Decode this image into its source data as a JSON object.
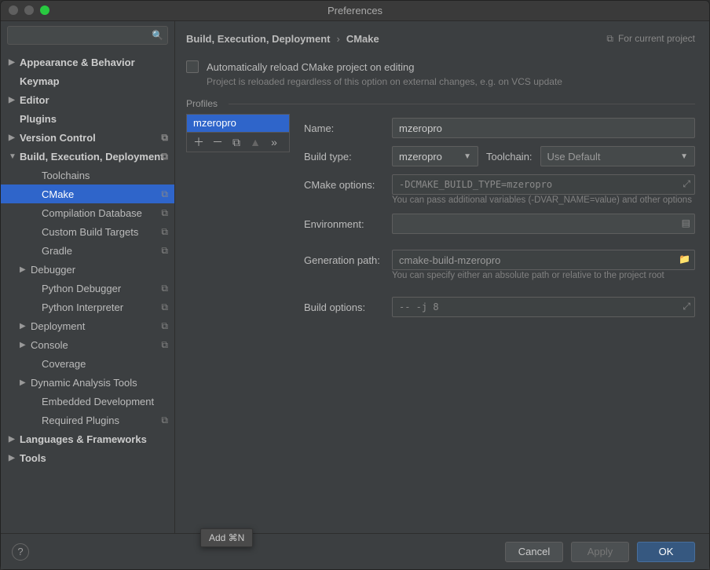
{
  "title": "Preferences",
  "search": {
    "placeholder": ""
  },
  "sidebar": {
    "items": [
      {
        "label": "Appearance & Behavior",
        "bold": true,
        "arrow": "▶"
      },
      {
        "label": "Keymap",
        "bold": true,
        "arrow": ""
      },
      {
        "label": "Editor",
        "bold": true,
        "arrow": "▶"
      },
      {
        "label": "Plugins",
        "bold": true,
        "arrow": ""
      },
      {
        "label": "Version Control",
        "bold": true,
        "arrow": "▶",
        "copy": true
      },
      {
        "label": "Build, Execution, Deployment",
        "bold": true,
        "arrow": "▼",
        "copy": true
      },
      {
        "label": "Toolchains",
        "indent": 2,
        "arrow": ""
      },
      {
        "label": "CMake",
        "indent": 2,
        "arrow": "",
        "selected": true,
        "copy": true
      },
      {
        "label": "Compilation Database",
        "indent": 2,
        "arrow": "",
        "copy": true
      },
      {
        "label": "Custom Build Targets",
        "indent": 2,
        "arrow": "",
        "copy": true
      },
      {
        "label": "Gradle",
        "indent": 2,
        "arrow": "",
        "copy": true
      },
      {
        "label": "Debugger",
        "indent": 1,
        "arrow": "▶"
      },
      {
        "label": "Python Debugger",
        "indent": 2,
        "arrow": "",
        "copy": true
      },
      {
        "label": "Python Interpreter",
        "indent": 2,
        "arrow": "",
        "copy": true
      },
      {
        "label": "Deployment",
        "indent": 1,
        "arrow": "▶",
        "copy": true
      },
      {
        "label": "Console",
        "indent": 1,
        "arrow": "▶",
        "copy": true
      },
      {
        "label": "Coverage",
        "indent": 2,
        "arrow": ""
      },
      {
        "label": "Dynamic Analysis Tools",
        "indent": 1,
        "arrow": "▶"
      },
      {
        "label": "Embedded Development",
        "indent": 2,
        "arrow": ""
      },
      {
        "label": "Required Plugins",
        "indent": 2,
        "arrow": "",
        "copy": true
      },
      {
        "label": "Languages & Frameworks",
        "bold": true,
        "arrow": "▶"
      },
      {
        "label": "Tools",
        "bold": true,
        "arrow": "▶"
      }
    ]
  },
  "breadcrumb": {
    "a": "Build, Execution, Deployment",
    "b": "CMake",
    "project_label": "For current project"
  },
  "auto": {
    "label": "Automatically reload CMake project on editing",
    "sub": "Project is reloaded regardless of this option on external changes, e.g. on VCS update"
  },
  "profiles_label": "Profiles",
  "profile_list": {
    "item": "mzeropro"
  },
  "form": {
    "name_label": "Name:",
    "name_value": "mzeropro",
    "build_type_label": "Build type:",
    "build_type_value": "mzeropro",
    "toolchain_label": "Toolchain:",
    "toolchain_value": "Use Default",
    "cmake_opts_label": "CMake options:",
    "cmake_opts_value": "-DCMAKE_BUILD_TYPE=mzeropro",
    "cmake_opts_help": "You can pass additional variables (-DVAR_NAME=value) and other options",
    "env_label": "Environment:",
    "gen_label": "Generation path:",
    "gen_value": "cmake-build-mzeropro",
    "gen_help": "You can specify either an absolute path or relative to the project root",
    "build_opts_label": "Build options:",
    "build_opts_value": "-- -j 8"
  },
  "tooltip": "Add  ⌘N",
  "footer": {
    "cancel": "Cancel",
    "apply": "Apply",
    "ok": "OK"
  }
}
